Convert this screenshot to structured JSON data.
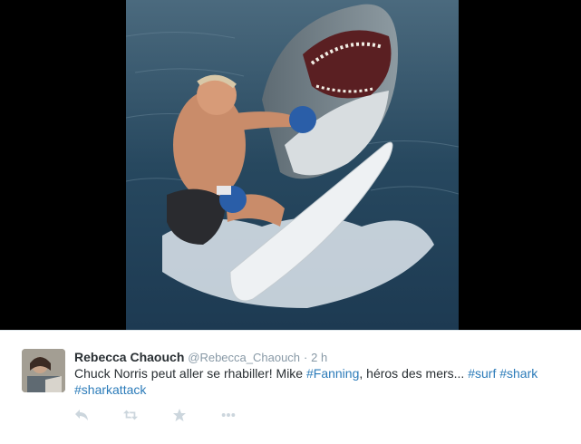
{
  "media": {
    "alt_icon": "photo-shark-surfer"
  },
  "tweet": {
    "fullname": "Rebecca Chaouch",
    "username": "@Rebecca_Chaouch",
    "separator": "·",
    "time": "2 h",
    "text_parts": [
      "Chuck Norris peut aller se rhabiller! Mike ",
      "#Fanning",
      ", héros des mers... ",
      "#surf",
      " ",
      "#shark",
      " ",
      "#sharkattack"
    ]
  },
  "actions": {
    "reply_icon": "reply-icon",
    "retweet_icon": "retweet-icon",
    "favorite_icon": "star-icon",
    "more_icon": "more-icon"
  },
  "colors": {
    "link": "#2b7bb9",
    "name": "#292f33",
    "muted": "#8899a6",
    "action_icon": "#ccd6dd"
  }
}
